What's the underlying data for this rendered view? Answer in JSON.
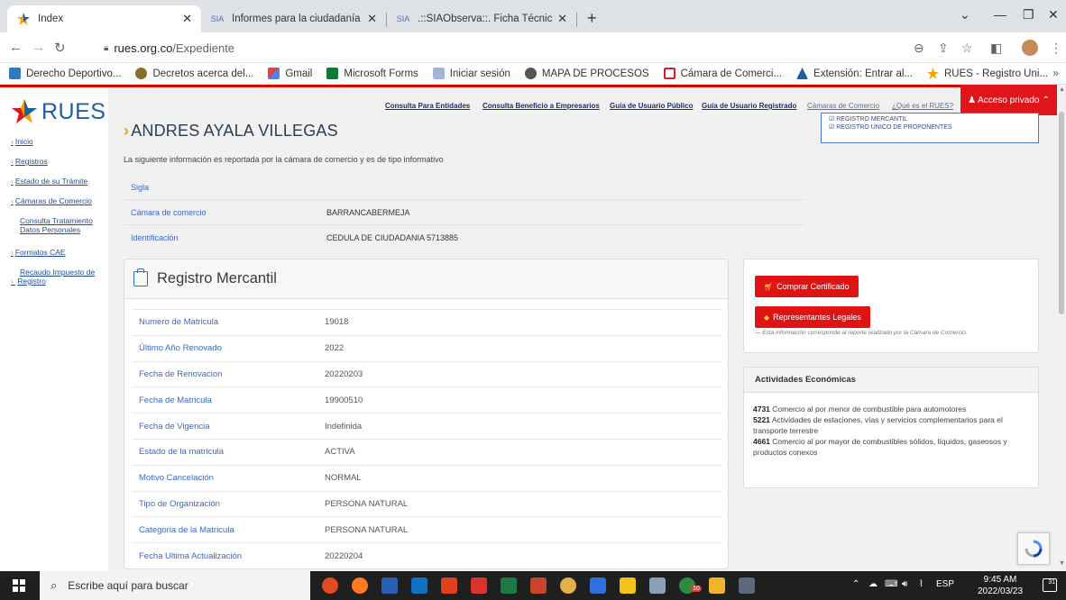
{
  "browser": {
    "tabs": [
      {
        "title": "Index",
        "active": true
      },
      {
        "title": "Informes para la ciudadanía",
        "active": false
      },
      {
        "title": ".::SIAObserva::. Ficha Técnica Con",
        "active": false
      }
    ],
    "url_host": "rues.org.co",
    "url_path": "/Expediente",
    "bookmarks": [
      "Derecho Deportivo...",
      "Decretos acerca del...",
      "Gmail",
      "Microsoft Forms",
      "Iniciar sesión",
      "MAPA DE PROCESOS",
      "Cámara de Comerci...",
      "Extensión: Entrar al...",
      "RUES - Registro Uni..."
    ]
  },
  "site": {
    "logo_text": "RUES",
    "sidebar": [
      {
        "label": "Inicio"
      },
      {
        "label": "Registros"
      },
      {
        "label": "Estado de su Trámite"
      },
      {
        "label": "Cámaras de Comercio"
      },
      {
        "label_line1": "Consulta Tratamiento",
        "label_line2": "Datos Personales"
      },
      {
        "label": "Formatos CAE"
      },
      {
        "label_line1": "Recaudo Impuesto de",
        "label_line2": "Registro"
      }
    ],
    "topmenu": [
      "Consulta Para Entidades",
      "Consulta Beneficio a Empresarios",
      "Guía de Usuario Público",
      "Guía de Usuario Registrado",
      "Cámaras de Comercio",
      "¿Qué es el RUES?"
    ],
    "acceso_label": "Acceso privado",
    "registro_box": [
      "REGISTRO MERCANTIL",
      "REGISTRO UNICO DE PROPONENTES"
    ]
  },
  "expediente": {
    "name": "ANDRES AYALA VILLEGAS",
    "info_text": "La siguiente información es reportada por la cámara de comercio y es de tipo informativo",
    "summary": [
      {
        "label": "Sigla",
        "value": ""
      },
      {
        "label": "Cámara de comercio",
        "value": "BARRANCABERMEJA"
      },
      {
        "label": "Identificación",
        "value": "CEDULA DE CIUDADANIA 5713885"
      }
    ],
    "registro_title": "Registro Mercantil",
    "registro": [
      {
        "label": "Numero de Matricula",
        "value": "19018"
      },
      {
        "label": "Último Año Renovado",
        "value": "2022"
      },
      {
        "label": "Fecha de Renovacion",
        "value": "20220203"
      },
      {
        "label": "Fecha de Matricula",
        "value": "19900510"
      },
      {
        "label": "Fecha de Vigencia",
        "value": "Indefinida"
      },
      {
        "label": "Estado de la matricula",
        "value": "ACTIVA"
      },
      {
        "label": "Motivo Cancelación",
        "value": "NORMAL"
      },
      {
        "label": "Tipo de Organización",
        "value": "PERSONA NATURAL"
      },
      {
        "label": "Categoria de la Matricula",
        "value": "PERSONA NATURAL"
      },
      {
        "label": "Fecha Ultima Actualización",
        "value": "20220204"
      }
    ],
    "btn_certificado": "Comprar Certificado",
    "btn_representantes": "Representantes Legales",
    "note": "— Esta información corresponde al reporte realizado por la Cámara de Comercio.",
    "actividades_title": "Actividades Económicas",
    "actividades": [
      {
        "code": "4731",
        "text": "Comercio al por menor de combustible para automotores"
      },
      {
        "code": "5221",
        "text": "Actividades de estaciones, vías y servicios complementarios para el transporte terrestre"
      },
      {
        "code": "4661",
        "text": "Comercio al por mayor de combustibles sólidos, líquidos, gaseosos y productos conexos"
      }
    ]
  },
  "taskbar": {
    "search_placeholder": "Escribe aquí para buscar",
    "lang": "ESP",
    "time": "9:45 AM",
    "date": "2022/03/23",
    "notif_count": "31",
    "badge": "10"
  },
  "colors": {
    "brand_red": "#e0141b",
    "link_blue": "#3a68c4",
    "accent_orange": "#f3a100"
  }
}
